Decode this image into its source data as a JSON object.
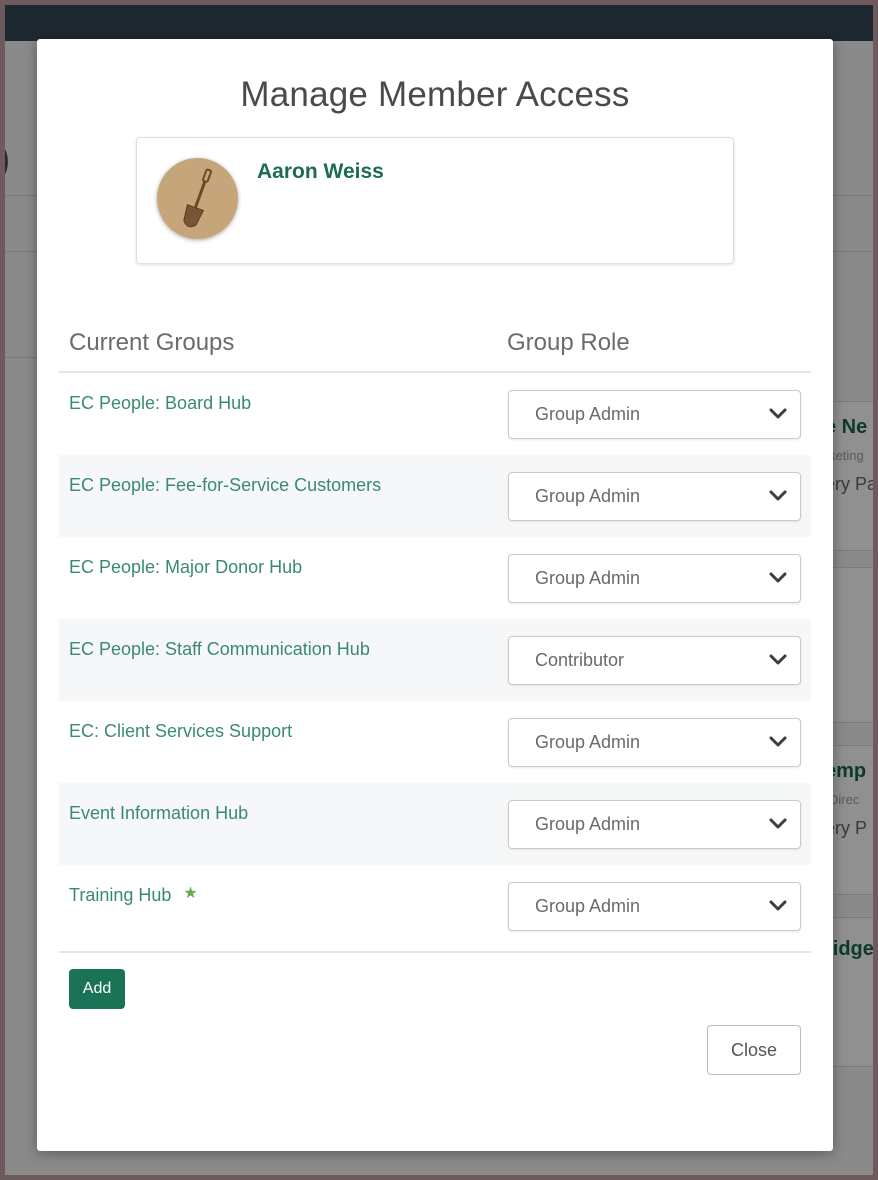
{
  "modal": {
    "title": "Manage Member Access",
    "member": {
      "name": "Aaron Weiss",
      "avatar_icon": "shovel-icon"
    },
    "columns": {
      "groups": "Current Groups",
      "role": "Group Role"
    },
    "groups": [
      {
        "name": "EC People: Board Hub",
        "role": "Group Admin",
        "starred": false
      },
      {
        "name": "EC People: Fee-for-Service Customers",
        "role": "Group Admin",
        "starred": false
      },
      {
        "name": "EC People: Major Donor Hub",
        "role": "Group Admin",
        "starred": false
      },
      {
        "name": "EC People: Staff Communication Hub",
        "role": "Contributor",
        "starred": false
      },
      {
        "name": "EC: Client Services Support",
        "role": "Group Admin",
        "starred": false
      },
      {
        "name": "Event Information Hub",
        "role": "Group Admin",
        "starred": false
      },
      {
        "name": "Training Hub",
        "role": "Group Admin",
        "starred": true
      }
    ],
    "add_label": "Add",
    "close_label": "Close"
  },
  "background": {
    "cards": [
      {
        "title": "e Ne",
        "subtitle": "keting",
        "line": "ery Pa"
      },
      {
        "title": "emp",
        "subtitle": "Direc",
        "line": "ery P"
      },
      {
        "title": "ridge",
        "subtitle": "",
        "line": ""
      }
    ],
    "left_glyph": ")"
  },
  "colors": {
    "accent": "#1b7357",
    "link": "#3a8a73",
    "star": "#6aa84f",
    "topbar": "#1e2830"
  }
}
